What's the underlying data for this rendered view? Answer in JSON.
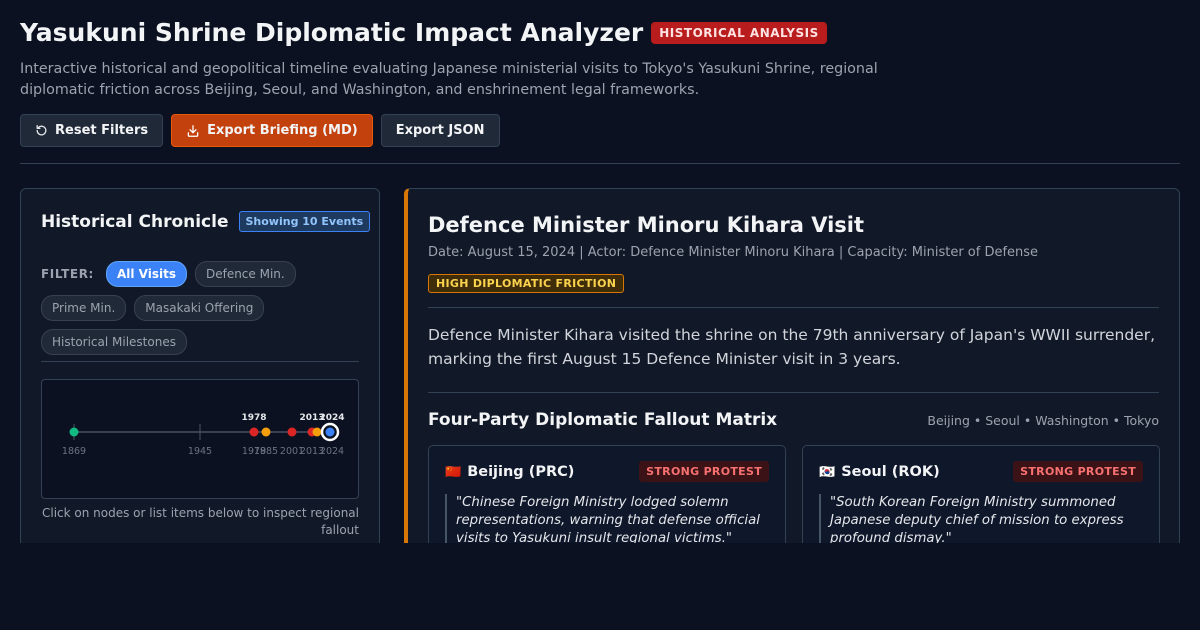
{
  "header": {
    "title": "Yasukuni Shrine Diplomatic Impact Analyzer",
    "badge": "HISTORICAL ANALYSIS",
    "subtitle": "Interactive historical and geopolitical timeline evaluating Japanese ministerial visits to Tokyo's Yasukuni Shrine, regional diplomatic friction across Beijing, Seoul, and Washington, and enshrinement legal frameworks."
  },
  "toolbar": {
    "reset_label": "Reset Filters",
    "reset_icon": "reset-icon",
    "export_md_label": "Export Briefing (MD)",
    "export_md_icon": "download-icon",
    "export_json_label": "Export JSON"
  },
  "chronicle": {
    "title": "Historical Chronicle",
    "count_badge": "Showing 10 Events",
    "filter_label": "FILTER:",
    "filters": [
      "All Visits",
      "Defence Min.",
      "Prime Min.",
      "Masakaki Offering",
      "Historical Milestones"
    ],
    "active_filter": "All Visits",
    "timeline": {
      "axis_labels": [
        "1869",
        "1945",
        "1978",
        "1985",
        "2001",
        "2013",
        "2024"
      ],
      "highlight_labels": [
        "1978",
        "2013",
        "2024"
      ],
      "events": [
        {
          "year": 1869,
          "color": "#10b981"
        },
        {
          "year": 1978,
          "color": "#dc2626"
        },
        {
          "year": 1985,
          "color": "#f59e0b"
        },
        {
          "year": 2001,
          "color": "#dc2626"
        },
        {
          "year": 2013,
          "color": "#dc2626"
        },
        {
          "year": 2014,
          "color": "#f59e0b"
        },
        {
          "year": 2024,
          "color": "#3b82f6",
          "selected": true
        }
      ]
    },
    "hint": "Click on nodes or list items below to inspect regional fallout"
  },
  "detail": {
    "title": "Defence Minister Minoru Kihara Visit",
    "meta": "Date: August 15, 2024 | Actor: Defence Minister Minoru Kihara | Capacity: Minister of Defense",
    "friction_badge": "HIGH DIPLOMATIC FRICTION",
    "description": "Defence Minister Kihara visited the shrine on the 79th anniversary of Japan's WWII surrender, marking the first August 15 Defence Minister visit in 3 years.",
    "matrix_title": "Four-Party Diplomatic Fallout Matrix",
    "matrix_parties": "Beijing • Seoul • Washington • Tokyo",
    "cards": [
      {
        "flag": "🇨🇳",
        "name": "Beijing (PRC)",
        "status": "STRONG PROTEST",
        "quote": "\"Chinese Foreign Ministry lodged solemn representations, warning that defense official visits to Yasukuni insult regional victims.\""
      },
      {
        "flag": "🇰🇷",
        "name": "Seoul (ROK)",
        "status": "STRONG PROTEST",
        "quote": "\"South Korean Foreign Ministry summoned Japanese deputy chief of mission to express profound dismay.\""
      }
    ]
  },
  "colors": {
    "background": "#0b1120",
    "accent_orange": "#c2410c",
    "accent_blue": "#3b82f6",
    "alert_red": "#b91c1c",
    "friction_amber": "#d97706"
  }
}
